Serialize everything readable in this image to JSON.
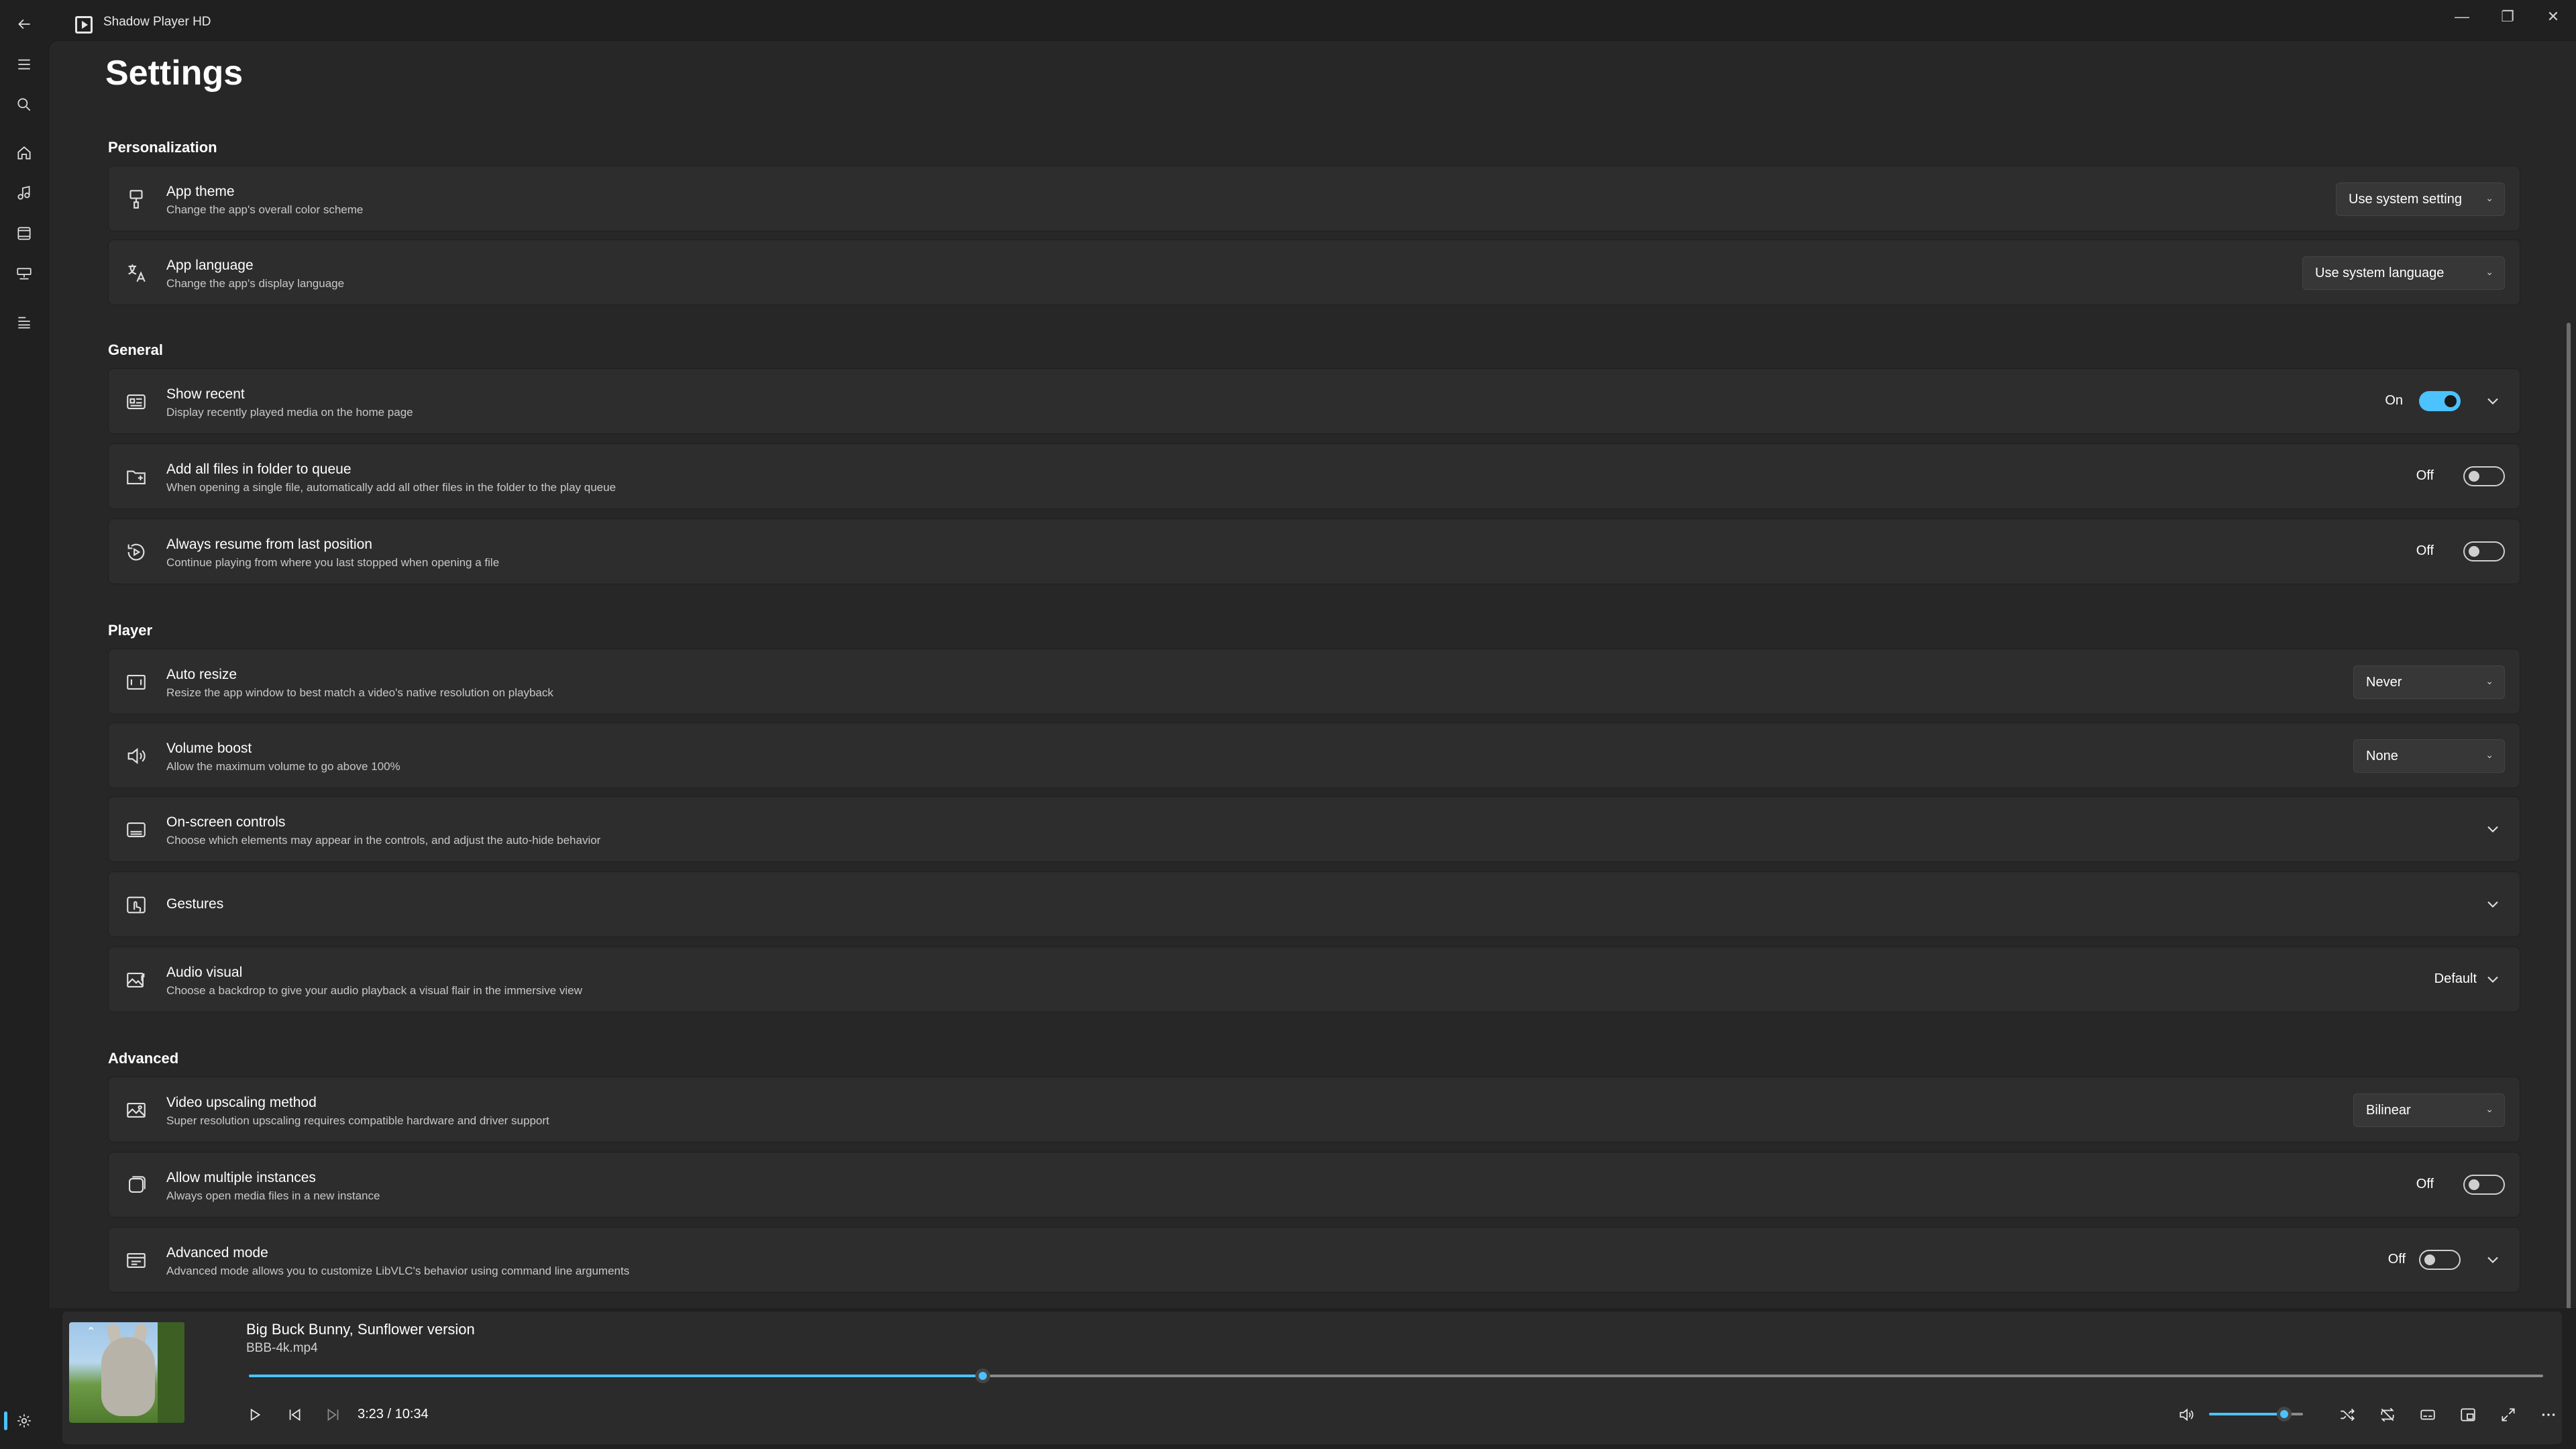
{
  "app": {
    "title": "Shadow Player HD"
  },
  "window": {
    "minimize": "—",
    "maximize": "❐",
    "close": "✕"
  },
  "page": {
    "title": "Settings"
  },
  "sections": {
    "personalization": "Personalization",
    "general": "General",
    "player": "Player",
    "advanced": "Advanced"
  },
  "settings": {
    "app_theme": {
      "title": "App theme",
      "desc": "Change the app's overall color scheme",
      "value": "Use system setting"
    },
    "app_language": {
      "title": "App language",
      "desc": "Change the app's display language",
      "value": "Use system language"
    },
    "show_recent": {
      "title": "Show recent",
      "desc": "Display recently played media on the home page",
      "state": "On"
    },
    "add_folder": {
      "title": "Add all files in folder to queue",
      "desc": "When opening a single file, automatically add all other files in the folder to the play queue",
      "state": "Off"
    },
    "resume": {
      "title": "Always resume from last position",
      "desc": "Continue playing from where you last stopped when opening a file",
      "state": "Off"
    },
    "auto_resize": {
      "title": "Auto resize",
      "desc": "Resize the app window to best match a video's native resolution on playback",
      "value": "Never"
    },
    "volume_boost": {
      "title": "Volume boost",
      "desc": "Allow the maximum volume to go above 100%",
      "value": "None"
    },
    "onscreen_controls": {
      "title": "On-screen controls",
      "desc": "Choose which elements may appear in the controls, and adjust the auto-hide behavior"
    },
    "gestures": {
      "title": "Gestures"
    },
    "audio_visual": {
      "title": "Audio visual",
      "desc": "Choose a backdrop to give your audio playback a visual flair in the immersive view",
      "value": "Default"
    },
    "upscaling": {
      "title": "Video upscaling method",
      "desc": "Super resolution upscaling requires compatible hardware and driver support",
      "value": "Bilinear"
    },
    "multi_instance": {
      "title": "Allow multiple instances",
      "desc": "Always open media files in a new instance",
      "state": "Off"
    },
    "advanced_mode": {
      "title": "Advanced mode",
      "desc": "Advanced mode allows you to customize LibVLC's behavior using command line arguments",
      "state": "Off"
    }
  },
  "player": {
    "title": "Big Buck Bunny, Sunflower version",
    "file": "BBB-4k.mp4",
    "time": "3:23 / 10:34",
    "progress": 0.32,
    "volume": 0.8
  },
  "colors": {
    "accent": "#4cc2ff",
    "card": "#2d2d2d",
    "background": "#202020"
  }
}
